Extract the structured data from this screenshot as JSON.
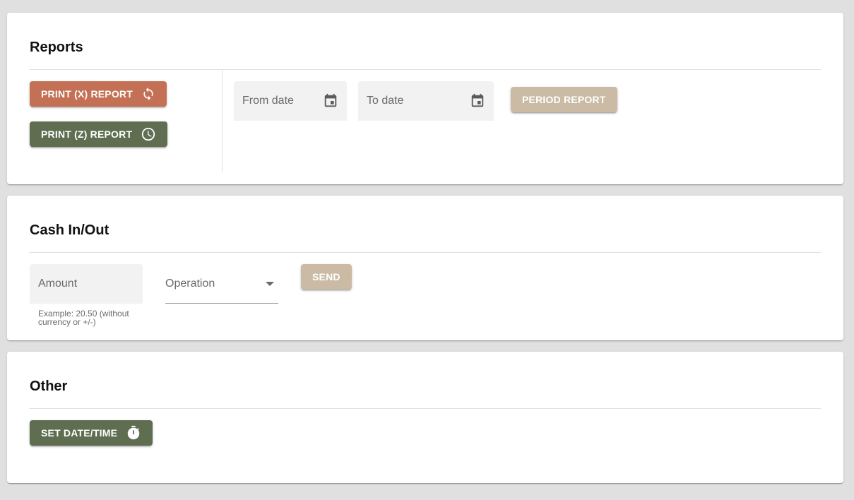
{
  "reports": {
    "title": "Reports",
    "print_x_label": "PRINT (X) REPORT",
    "print_z_label": "PRINT (Z) REPORT",
    "from_date_label": "From date",
    "to_date_label": "To date",
    "period_report_label": "PERIOD REPORT",
    "icons": {
      "print_x": "sync-icon",
      "print_z": "clock-icon",
      "from_date": "calendar-icon",
      "to_date": "calendar-icon"
    }
  },
  "cash": {
    "title": "Cash In/Out",
    "amount_label": "Amount",
    "amount_hint": "Example: 20.50 (without currency or +/-)",
    "operation_label": "Operation",
    "send_label": "SEND",
    "icons": {
      "operation": "dropdown-arrow-icon"
    }
  },
  "other": {
    "title": "Other",
    "set_datetime_label": "SET DATE/TIME",
    "icons": {
      "set_datetime": "stopwatch-icon"
    }
  },
  "colors": {
    "accent_x": "#c47055",
    "accent_green": "#5f6e51",
    "disabled_tan": "#cbbba5",
    "background": "#e0e0e0"
  }
}
